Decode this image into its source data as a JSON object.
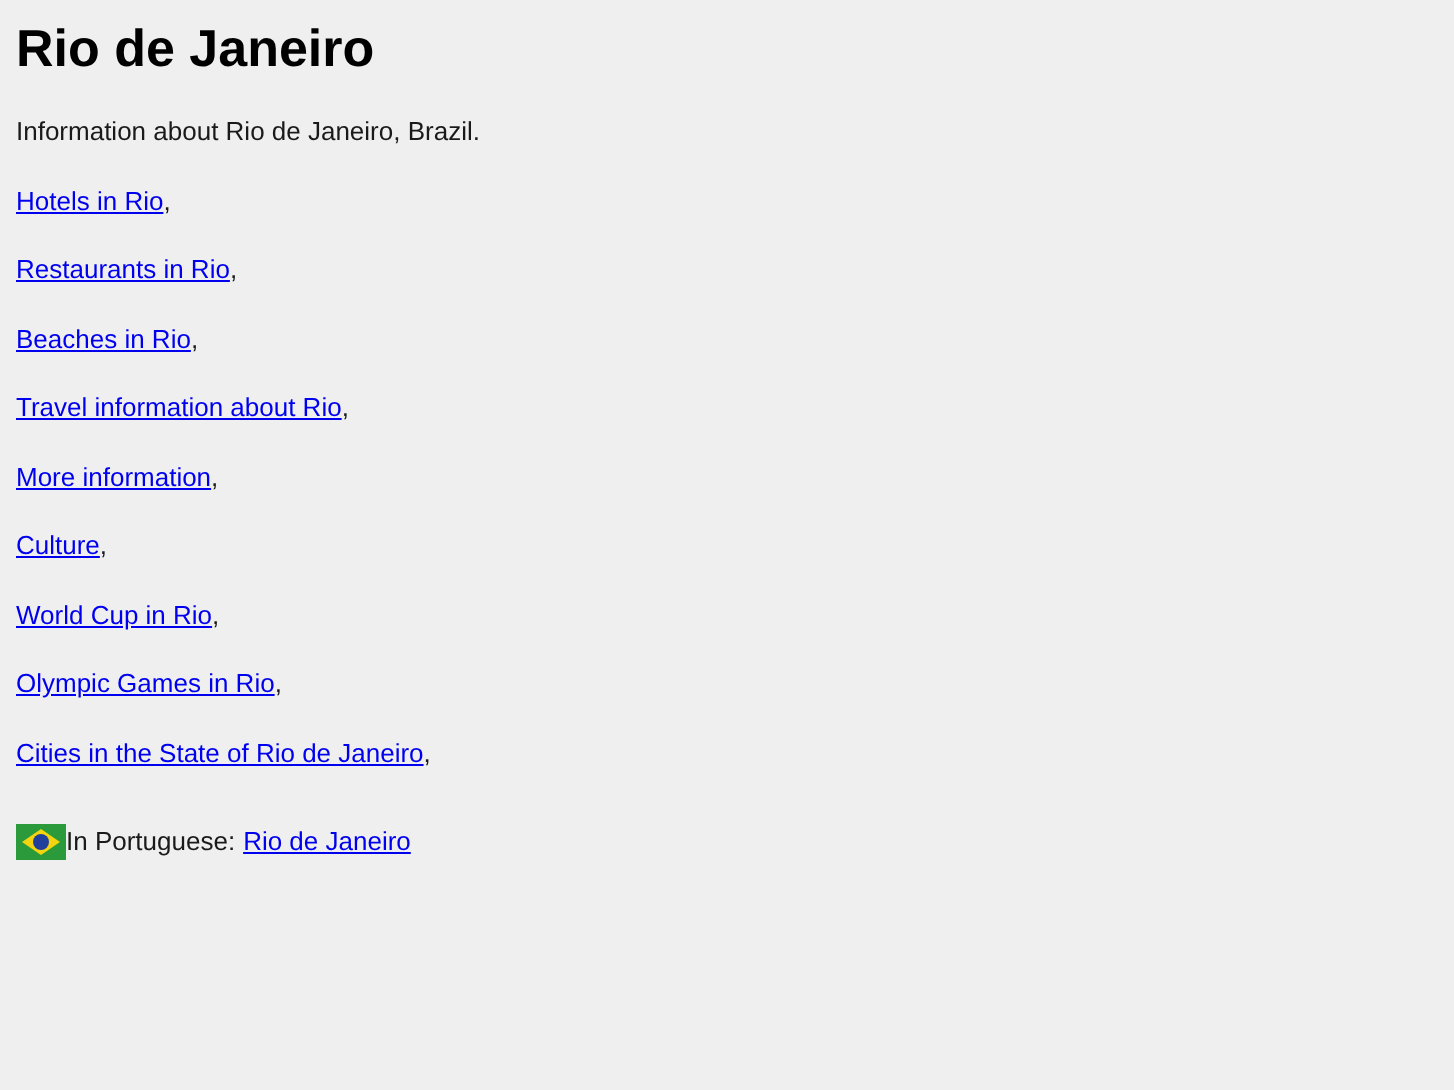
{
  "title": "Rio de Janeiro",
  "intro": "Information about Rio de Janeiro, Brazil.",
  "links": [
    {
      "label": "Hotels in Rio",
      "suffix": ","
    },
    {
      "label": "Restaurants in Rio",
      "suffix": ","
    },
    {
      "label": "Beaches in Rio",
      "suffix": ","
    },
    {
      "label": "Travel information about Rio",
      "suffix": ","
    },
    {
      "label": "More information",
      "suffix": ","
    },
    {
      "label": "Culture",
      "suffix": ","
    },
    {
      "label": "World Cup in Rio",
      "suffix": ","
    },
    {
      "label": "Olympic Games in Rio",
      "suffix": ","
    },
    {
      "label": "Cities in the State of Rio de Janeiro",
      "suffix": ","
    }
  ],
  "language": {
    "label": "In Portuguese:",
    "link": "Rio de Janeiro"
  }
}
